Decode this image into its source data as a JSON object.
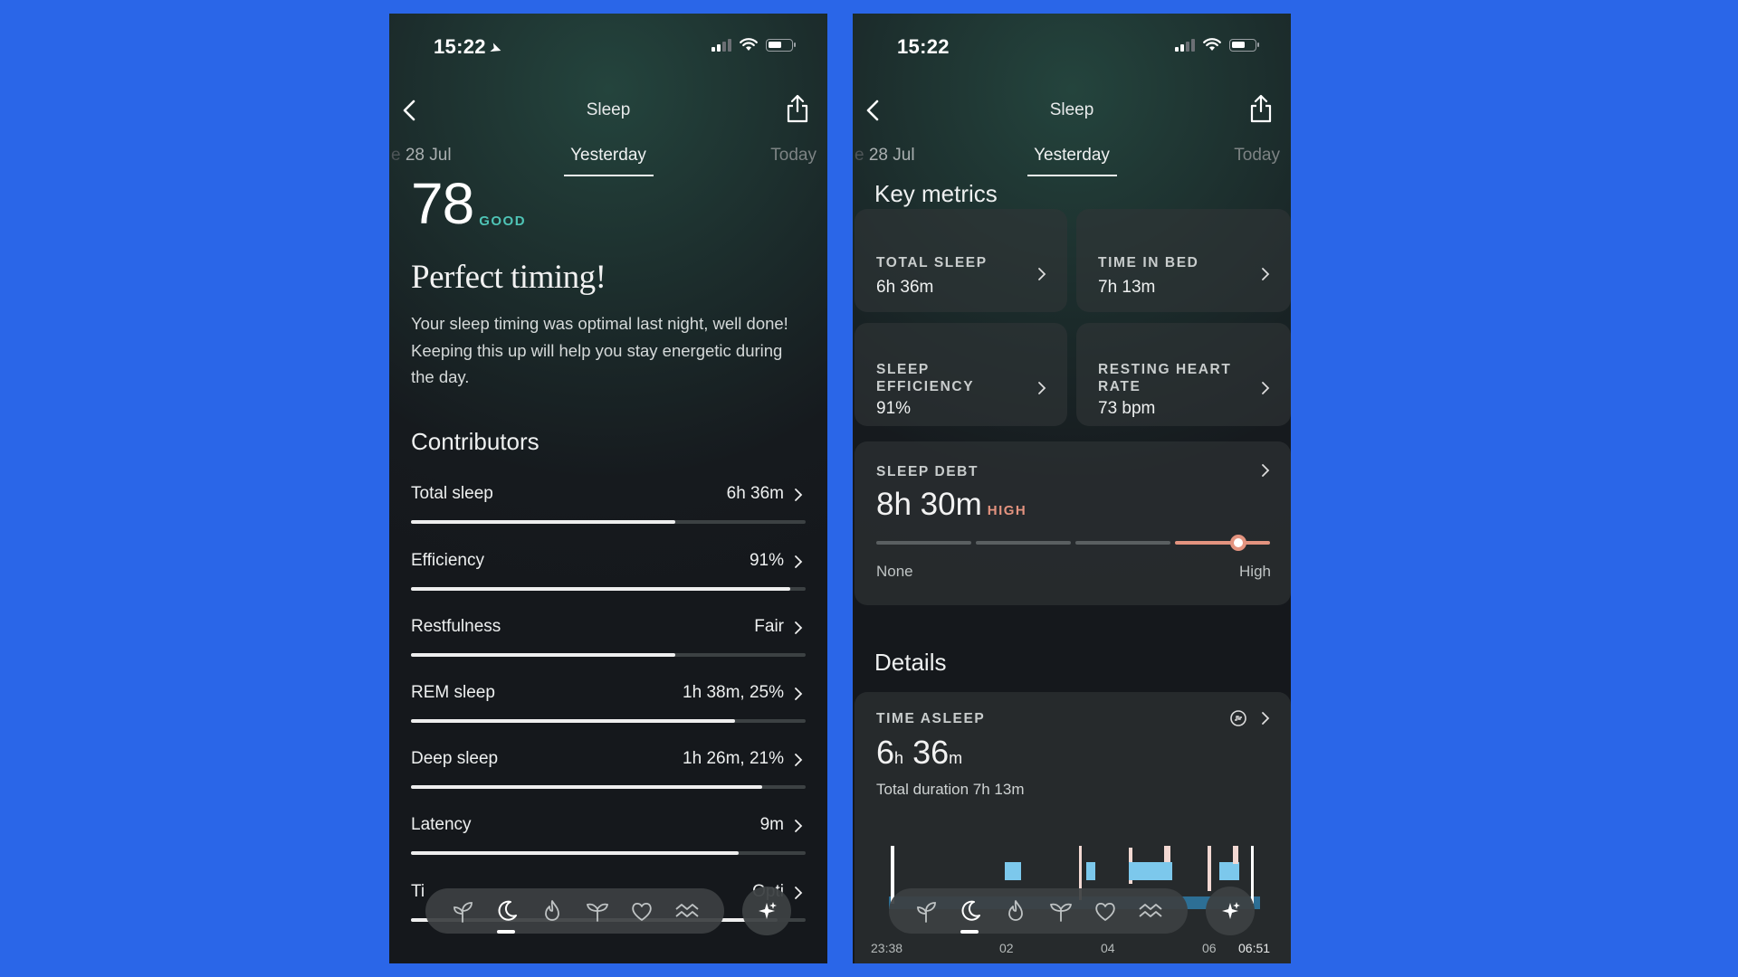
{
  "status_bar": {
    "time": "15:22"
  },
  "nav": {
    "title": "Sleep"
  },
  "date_tabs": {
    "prev": "28 Jul",
    "prev_fade": "e",
    "current": "Yesterday",
    "next": "Today"
  },
  "left": {
    "score": "78",
    "score_label": "GOOD",
    "headline": "Perfect timing!",
    "summary": "Your sleep timing was optimal last night, well done! Keeping this up will help you stay energetic during the day.",
    "contributors_title": "Contributors",
    "contributors": [
      {
        "name": "Total sleep",
        "value": "6h 36m",
        "fill": 0.67
      },
      {
        "name": "Efficiency",
        "value": "91%",
        "fill": 0.96
      },
      {
        "name": "Restfulness",
        "value": "Fair",
        "fill": 0.67
      },
      {
        "name": "REM sleep",
        "value": "1h 38m, 25%",
        "fill": 0.82
      },
      {
        "name": "Deep sleep",
        "value": "1h 26m, 21%",
        "fill": 0.89
      },
      {
        "name": "Latency",
        "value": "9m",
        "fill": 0.83
      },
      {
        "name": "Ti",
        "value": "Opti",
        "fill": 0.93
      }
    ]
  },
  "right": {
    "key_metrics_title": "Key metrics",
    "metrics": [
      {
        "label": "TOTAL SLEEP",
        "value": "6h 36m"
      },
      {
        "label": "TIME IN BED",
        "value": "7h 13m"
      },
      {
        "label": "SLEEP EFFICIENCY",
        "label_line1": "SLEEP",
        "label_line2": "EFFICIENCY",
        "value": "91%"
      },
      {
        "label": "RESTING HEART RATE",
        "label_line1": "RESTING HEART",
        "label_line2": "RATE",
        "value": "73 bpm"
      }
    ],
    "sleep_debt": {
      "label": "SLEEP DEBT",
      "value": "8h 30m",
      "level": "HIGH",
      "min_label": "None",
      "max_label": "High",
      "level_fraction": 0.92
    },
    "details_title": "Details",
    "time_asleep": {
      "label": "TIME ASLEEP",
      "hours": "6",
      "hours_unit": "h",
      "minutes": "36",
      "minutes_unit": "m",
      "subtitle": "Total duration 7h 13m",
      "axis_labels": [
        "23:38",
        "02",
        "04",
        "06",
        "06:51"
      ]
    }
  },
  "tab_bar": {
    "icons": [
      "sprout-icon",
      "moon-icon",
      "flame-icon",
      "seedling-icon",
      "heart-icon",
      "waves-icon"
    ],
    "active": "moon-icon"
  },
  "colors": {
    "background": "#2a66e8",
    "good": "#4fc4b6",
    "high": "#e3937f",
    "hypnogram": "#7cc8ec"
  }
}
